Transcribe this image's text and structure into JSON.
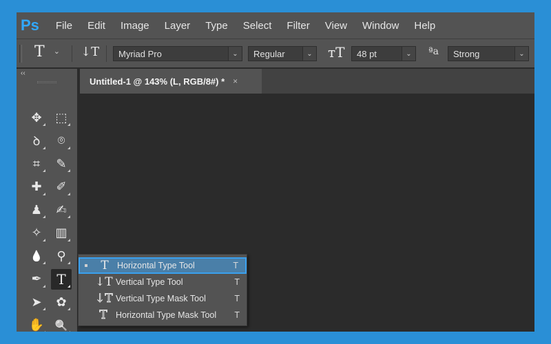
{
  "app": {
    "logo": "Ps",
    "menu": [
      "File",
      "Edit",
      "Image",
      "Layer",
      "Type",
      "Select",
      "Filter",
      "View",
      "Window",
      "Help"
    ]
  },
  "options": {
    "tool_preset_icon": "T",
    "orientation_icon": "↓T",
    "font_family": "Myriad Pro",
    "font_style": "Regular",
    "font_size_icon": "ᴛT",
    "font_size": "48 pt",
    "antialias_icon": "ªa",
    "antialias": "Strong"
  },
  "toolbar": {
    "collapse": "‹‹",
    "tools": [
      {
        "name": "move-icon",
        "glyph": "✥"
      },
      {
        "name": "rectangular-marquee-icon",
        "glyph": "⬚"
      },
      {
        "name": "lasso-icon",
        "glyph": "ꝺ"
      },
      {
        "name": "quick-selection-icon",
        "glyph": "⌾"
      },
      {
        "name": "crop-icon",
        "glyph": "⌗"
      },
      {
        "name": "eyedropper-icon",
        "glyph": "✎"
      },
      {
        "name": "healing-brush-icon",
        "glyph": "✚"
      },
      {
        "name": "brush-icon",
        "glyph": "✐"
      },
      {
        "name": "clone-stamp-icon",
        "glyph": "♟"
      },
      {
        "name": "history-brush-icon",
        "glyph": "✍"
      },
      {
        "name": "eraser-icon",
        "glyph": "✧"
      },
      {
        "name": "gradient-icon",
        "glyph": "▥"
      },
      {
        "name": "blur-icon",
        "glyph": "💧"
      },
      {
        "name": "dodge-icon",
        "glyph": "⚲"
      },
      {
        "name": "pen-icon",
        "glyph": "✒"
      },
      {
        "name": "type-tool-icon",
        "glyph": "T"
      },
      {
        "name": "path-selection-icon",
        "glyph": "➤"
      },
      {
        "name": "custom-shape-icon",
        "glyph": "✿"
      },
      {
        "name": "hand-icon",
        "glyph": "✋"
      },
      {
        "name": "zoom-icon",
        "glyph": "🔍"
      }
    ]
  },
  "document": {
    "tab_title": "Untitled-1 @ 143% (L, RGB/8#) *",
    "close": "×"
  },
  "type_flyout": {
    "items": [
      {
        "label": "Horizontal Type Tool",
        "key": "T",
        "icon": "T",
        "selected": true
      },
      {
        "label": "Vertical Type Tool",
        "key": "T",
        "icon": "↓T",
        "selected": false
      },
      {
        "label": "Vertical Type Mask Tool",
        "key": "T",
        "icon": "↓T",
        "selected": false
      },
      {
        "label": "Horizontal Type Mask Tool",
        "key": "T",
        "icon": "T",
        "selected": false
      }
    ]
  }
}
